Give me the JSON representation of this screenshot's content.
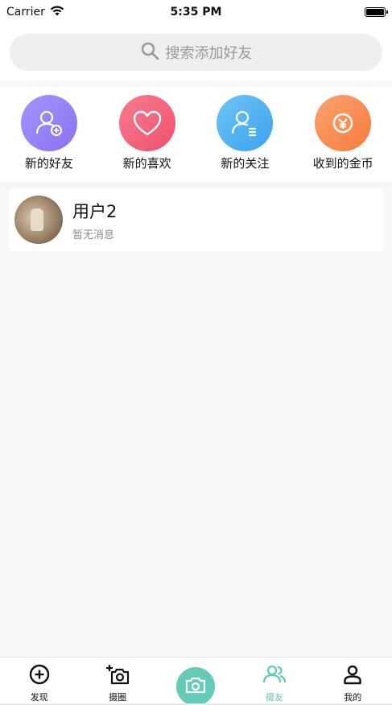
{
  "status_bar": {
    "carrier": "Carrier",
    "time": "5:35 PM"
  },
  "search": {
    "placeholder": "搜索添加好友"
  },
  "quick_actions": [
    {
      "label": "新的好友",
      "icon": "add-user-icon",
      "color": "#9a86f6"
    },
    {
      "label": "新的喜欢",
      "icon": "heart-icon",
      "color": "#f3607a"
    },
    {
      "label": "新的关注",
      "icon": "user-list-icon",
      "color": "#4fb2f2"
    },
    {
      "label": "收到的金币",
      "icon": "coin-icon",
      "color": "#fa8a50"
    }
  ],
  "conversations": [
    {
      "name": "用户2",
      "preview": "暂无消息"
    }
  ],
  "tab_bar": {
    "items": [
      {
        "label": "发现",
        "icon": "plus-circle-icon"
      },
      {
        "label": "摄圈",
        "icon": "camera-add-icon"
      },
      {
        "label": "",
        "icon": "camera-icon"
      },
      {
        "label": "摄友",
        "icon": "friends-icon"
      },
      {
        "label": "我的",
        "icon": "profile-icon"
      }
    ],
    "active_color": "#5ec9b7"
  }
}
